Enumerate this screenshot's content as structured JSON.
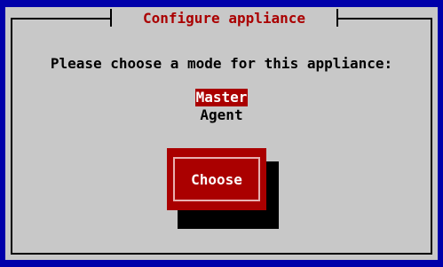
{
  "dialog": {
    "title": "Configure appliance",
    "prompt": "Please choose a mode for this appliance:",
    "modes": [
      {
        "label": "Master",
        "selected": true
      },
      {
        "label": "Agent",
        "selected": false
      }
    ],
    "choose_label": "Choose"
  },
  "colors": {
    "background": "#0000aa",
    "dialog": "#c8c8c8",
    "accent": "#aa0000",
    "selected_text": "#ffffff"
  }
}
